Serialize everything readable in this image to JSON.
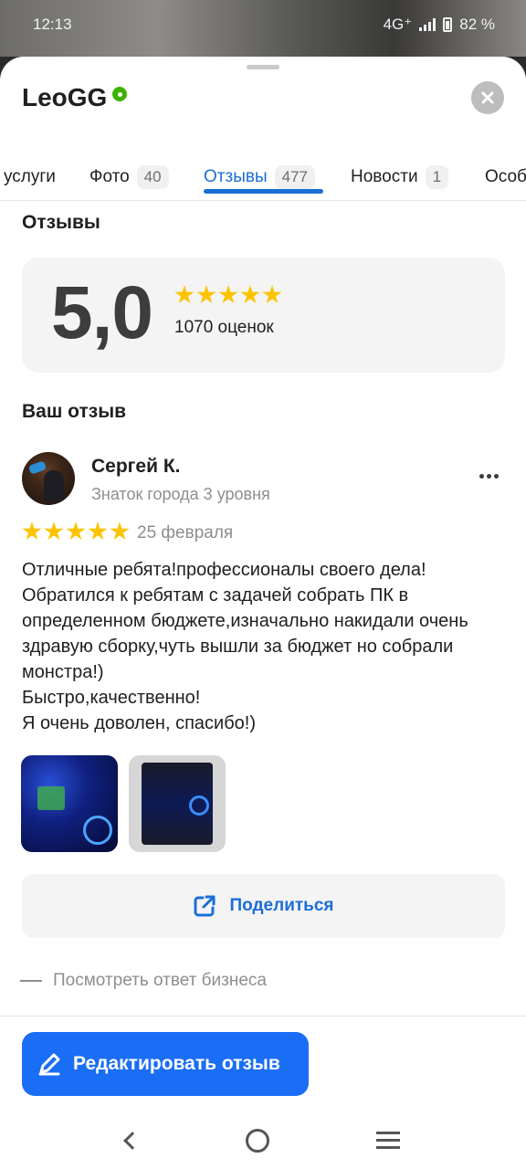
{
  "status_bar": {
    "time": "12:13",
    "battery": "82 %",
    "network": "4G⁺"
  },
  "header": {
    "title": "LeoGG"
  },
  "tabs": [
    {
      "label": "услуги",
      "count": ""
    },
    {
      "label": "Фото",
      "count": "40"
    },
    {
      "label": "Отзывы",
      "count": "477",
      "active": true
    },
    {
      "label": "Новости",
      "count": "1"
    },
    {
      "label": "Особ",
      "count": ""
    }
  ],
  "reviews_section": {
    "title": "Отзывы"
  },
  "rating": {
    "value": "5,0",
    "stars": 5,
    "count_label": "1070 оценок"
  },
  "your_review": {
    "title": "Ваш отзыв",
    "author": "Сергей К.",
    "author_level": "Знаток города 3 уровня",
    "stars": 5,
    "date": "25 февраля",
    "text": "Отличные ребята!профессионалы своего дела! Обратился к ребятам с задачей собрать ПК в определенном бюджете,изначально накидали очень здравую сборку,чуть вышли за бюджет но собрали монстра!)\nБыстро,качественно!\nЯ очень доволен, спасибо!)",
    "photos": [
      "pc-build-photo-1",
      "pc-build-photo-2"
    ],
    "share_label": "Поделиться",
    "business_reply_label": "Посмотреть ответ бизнеса"
  },
  "edit_button": {
    "label": "Редактировать отзыв"
  },
  "colors": {
    "accent": "#1a6ed8",
    "button": "#1a6ef5",
    "star": "#fcc400",
    "verified": "#3bb300"
  }
}
